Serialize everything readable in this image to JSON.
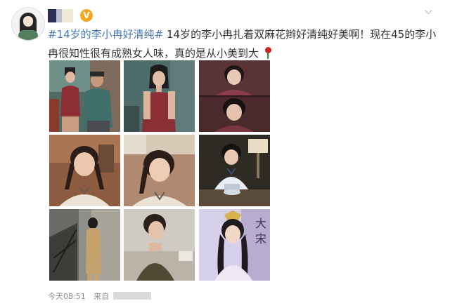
{
  "post": {
    "hashtag": "#14岁的李小冉好清纯#",
    "text": "14岁的李小冉扎着双麻花辫好清纯好美啊！现在45的李小冉很知性很有成熟女人味，真的是从小美到大",
    "emoji": "rose-emoji"
  },
  "user": {
    "verified_badge": "V",
    "verified_color": "#f6a623",
    "avatar_icon": "avatar-girl-icon"
  },
  "menu": {
    "icon": "chevron-down-icon",
    "glyph": "⌵"
  },
  "photos": [
    "photo-girl-with-older-man",
    "photo-girl-red-halter-top",
    "photo-stacked-portraits",
    "photo-braids-smiling",
    "photo-braids-portrait",
    "photo-cheongsam-seated",
    "photo-staircase-back-view",
    "photo-girl-green-top",
    "photo-costume-drama-poster"
  ],
  "footer": {
    "time": "今天08:51",
    "source_prefix": "来自"
  },
  "colors": {
    "link": "#4a78b8",
    "meta": "#8c8c8c",
    "text": "#333333"
  }
}
